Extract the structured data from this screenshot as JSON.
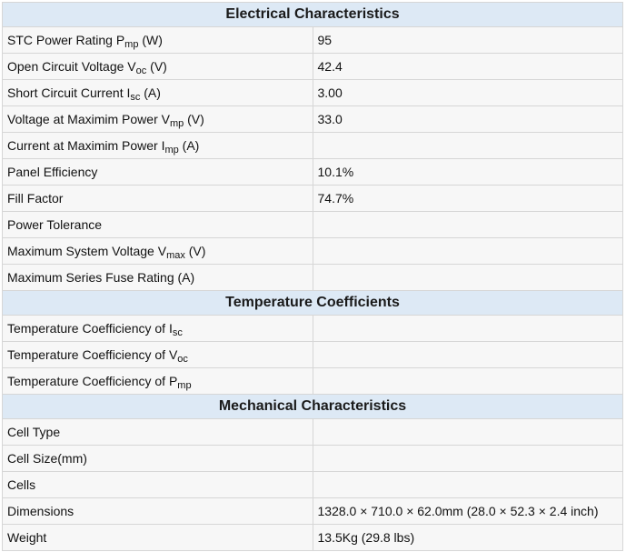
{
  "sections": {
    "electrical": {
      "title": "Electrical Characteristics",
      "rows": [
        {
          "label": "STC Power Rating P",
          "sub": "mp",
          "suffix": " (W)",
          "value": "95"
        },
        {
          "label": "Open Circuit Voltage V",
          "sub": "oc",
          "suffix": " (V)",
          "value": "42.4"
        },
        {
          "label": "Short Circuit Current I",
          "sub": "sc",
          "suffix": " (A)",
          "value": "3.00"
        },
        {
          "label": "Voltage at Maximim Power V",
          "sub": "mp",
          "suffix": " (V)",
          "value": "33.0"
        },
        {
          "label": "Current at Maximim Power I",
          "sub": "mp",
          "suffix": " (A)",
          "value": ""
        },
        {
          "label": "Panel Efficiency",
          "sub": "",
          "suffix": "",
          "value": "10.1%"
        },
        {
          "label": "Fill Factor",
          "sub": "",
          "suffix": "",
          "value": "74.7%"
        },
        {
          "label": "Power Tolerance",
          "sub": "",
          "suffix": "",
          "value": ""
        },
        {
          "label": "Maximum System Voltage V",
          "sub": "max",
          "suffix": " (V)",
          "value": ""
        },
        {
          "label": "Maximum Series Fuse Rating (A)",
          "sub": "",
          "suffix": "",
          "value": ""
        }
      ]
    },
    "temperature": {
      "title": "Temperature Coefficients",
      "rows": [
        {
          "label": "Temperature Coefficiency of I",
          "sub": "sc",
          "suffix": "",
          "value": ""
        },
        {
          "label": "Temperature Coefficiency of V",
          "sub": "oc",
          "suffix": "",
          "value": ""
        },
        {
          "label": "Temperature Coefficiency of P",
          "sub": "mp",
          "suffix": "",
          "value": ""
        }
      ]
    },
    "mechanical": {
      "title": "Mechanical Characteristics",
      "rows": [
        {
          "label": "Cell Type",
          "value": ""
        },
        {
          "label": "Cell Size(mm)",
          "value": ""
        },
        {
          "label": "Cells",
          "value": ""
        },
        {
          "label": "Dimensions",
          "value": "1328.0 × 710.0 × 62.0mm (28.0 × 52.3 × 2.4 inch)"
        },
        {
          "label": "Weight",
          "value": "13.5Kg (29.8 lbs)"
        }
      ]
    }
  }
}
